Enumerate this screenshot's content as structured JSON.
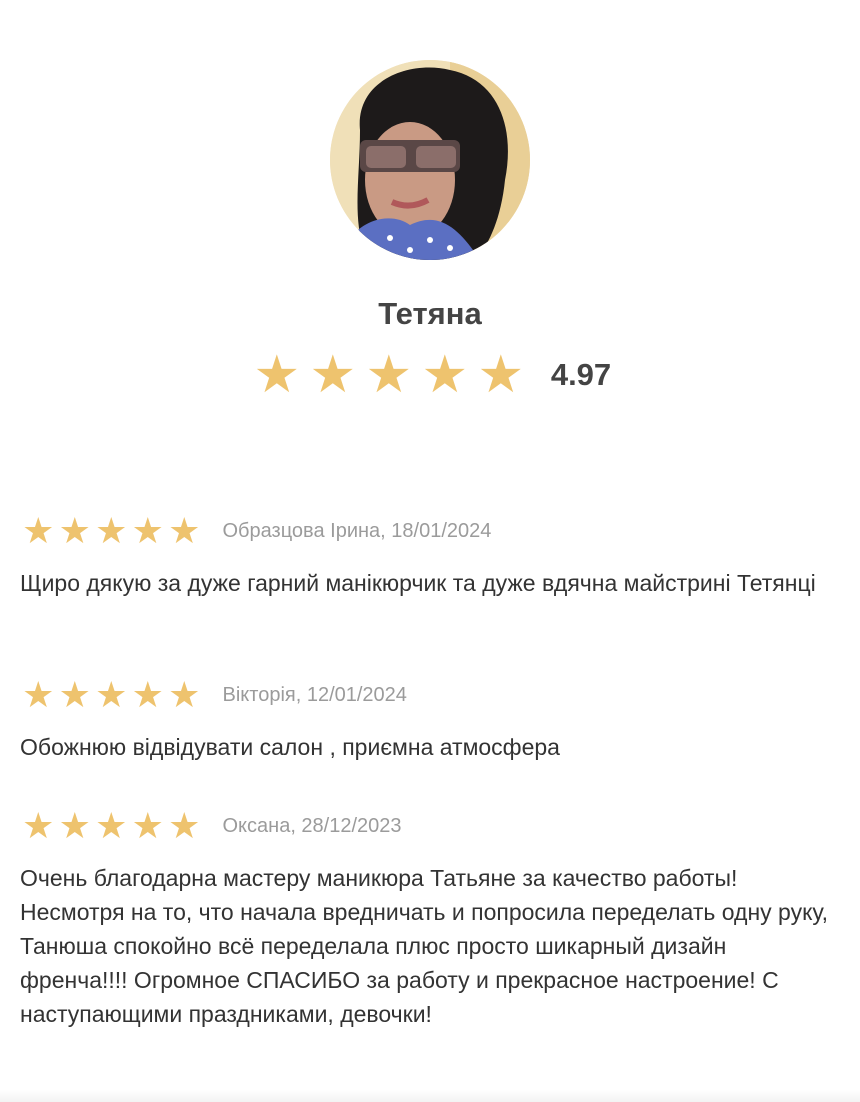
{
  "profile": {
    "name": "Тетяна",
    "rating_value": "4.97",
    "rating_stars": 5,
    "star_color": "#eec36e"
  },
  "reviews": [
    {
      "stars": 5,
      "meta": "Образцова Ірина, 18/01/2024",
      "text": "Щиро дякую за дуже гарний манікюрчик та дуже вдячна майстрині Тетянці"
    },
    {
      "stars": 5,
      "meta": "Вікторія, 12/01/2024",
      "text": "Обожнюю відвідувати салон , приємна атмосфера"
    },
    {
      "stars": 5,
      "meta": "Оксана, 28/12/2023",
      "text": "Очень благодарна мастеру маникюра Татьяне за качество работы! Несмотря на то, что начала вредничать и попросила переделать одну руку, Танюша спокойно всё переделала плюс просто шикарный дизайн френча!!!! Огромное СПАСИБО за работу и прекрасное настроение! С наступающими праздниками, девочки!"
    }
  ]
}
